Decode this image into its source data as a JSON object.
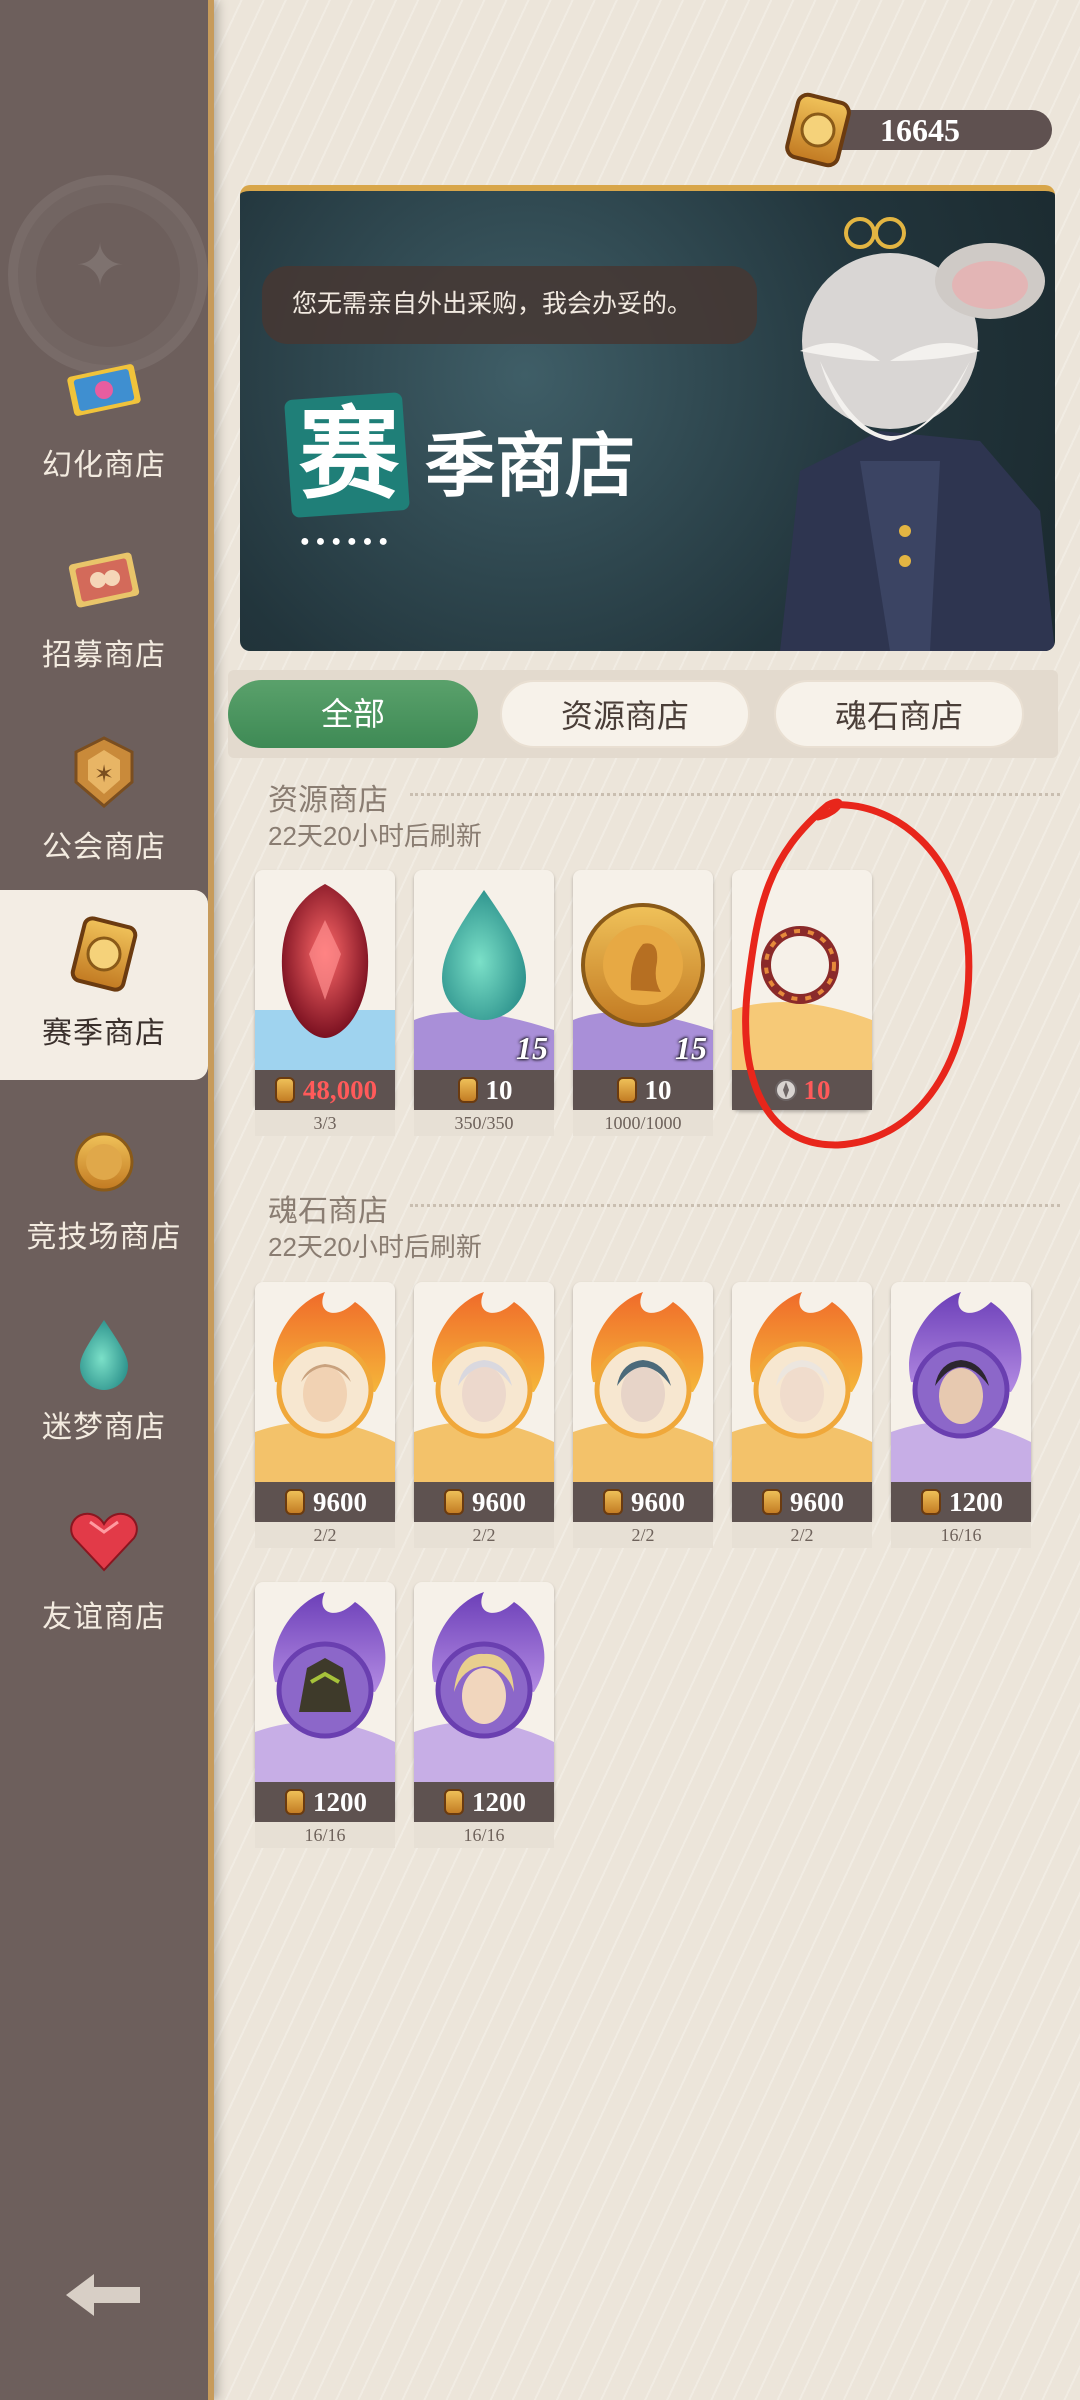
{
  "currency": {
    "amount": "16645",
    "icon": "gold-coin-icon"
  },
  "sidebar": {
    "items": [
      {
        "label": "幻化商店",
        "icon": "ticket-icon",
        "active": false
      },
      {
        "label": "招募商店",
        "icon": "recruit-card-icon",
        "active": false
      },
      {
        "label": "公会商店",
        "icon": "guild-emblem-icon",
        "active": false
      },
      {
        "label": "赛季商店",
        "icon": "season-coin-icon",
        "active": true
      },
      {
        "label": "竞技场商店",
        "icon": "arena-coin-icon",
        "active": false
      },
      {
        "label": "迷梦商店",
        "icon": "dream-drop-icon",
        "active": false
      },
      {
        "label": "友谊商店",
        "icon": "heart-gem-icon",
        "active": false
      }
    ],
    "back_icon": "back-arrow-icon"
  },
  "banner": {
    "speech": "您无需亲自外出采购，我会办妥的。",
    "title_big": "赛",
    "title_rest": "季商店"
  },
  "tabs": [
    {
      "label": "全部",
      "active": true
    },
    {
      "label": "资源商店",
      "active": false
    },
    {
      "label": "魂石商店",
      "active": false
    }
  ],
  "sections": {
    "resource": {
      "title": "资源商店",
      "refresh": "22天20小时后刷新",
      "items": [
        {
          "name": "red-crystal",
          "price": "48,000",
          "price_red": true,
          "stock": "3/3",
          "badge": ""
        },
        {
          "name": "green-drop",
          "price": "10",
          "price_red": false,
          "stock": "350/350",
          "badge": "15"
        },
        {
          "name": "gold-medal",
          "price": "10",
          "price_red": false,
          "stock": "1000/1000",
          "badge": "15"
        },
        {
          "name": "fire-ring",
          "price": "10",
          "price_red": true,
          "stock": "",
          "badge": ""
        }
      ]
    },
    "soulstone": {
      "title": "魂石商店",
      "refresh": "22天20小时后刷新",
      "items": [
        {
          "name": "soulstone-fire-1",
          "price": "9600",
          "stock": "2/2"
        },
        {
          "name": "soulstone-fire-2",
          "price": "9600",
          "stock": "2/2"
        },
        {
          "name": "soulstone-fire-3",
          "price": "9600",
          "stock": "2/2"
        },
        {
          "name": "soulstone-fire-4",
          "price": "9600",
          "stock": "2/2"
        },
        {
          "name": "soulstone-purple-1",
          "price": "1200",
          "stock": "16/16"
        },
        {
          "name": "soulstone-purple-2",
          "price": "1200",
          "stock": "16/16"
        },
        {
          "name": "soulstone-purple-3",
          "price": "1200",
          "stock": "16/16"
        }
      ]
    }
  },
  "colors": {
    "accent_green": "#4a955f",
    "sidebar": "#6d5f5c",
    "price_red": "#ff5a5a",
    "annotation_red": "#e8261b"
  }
}
